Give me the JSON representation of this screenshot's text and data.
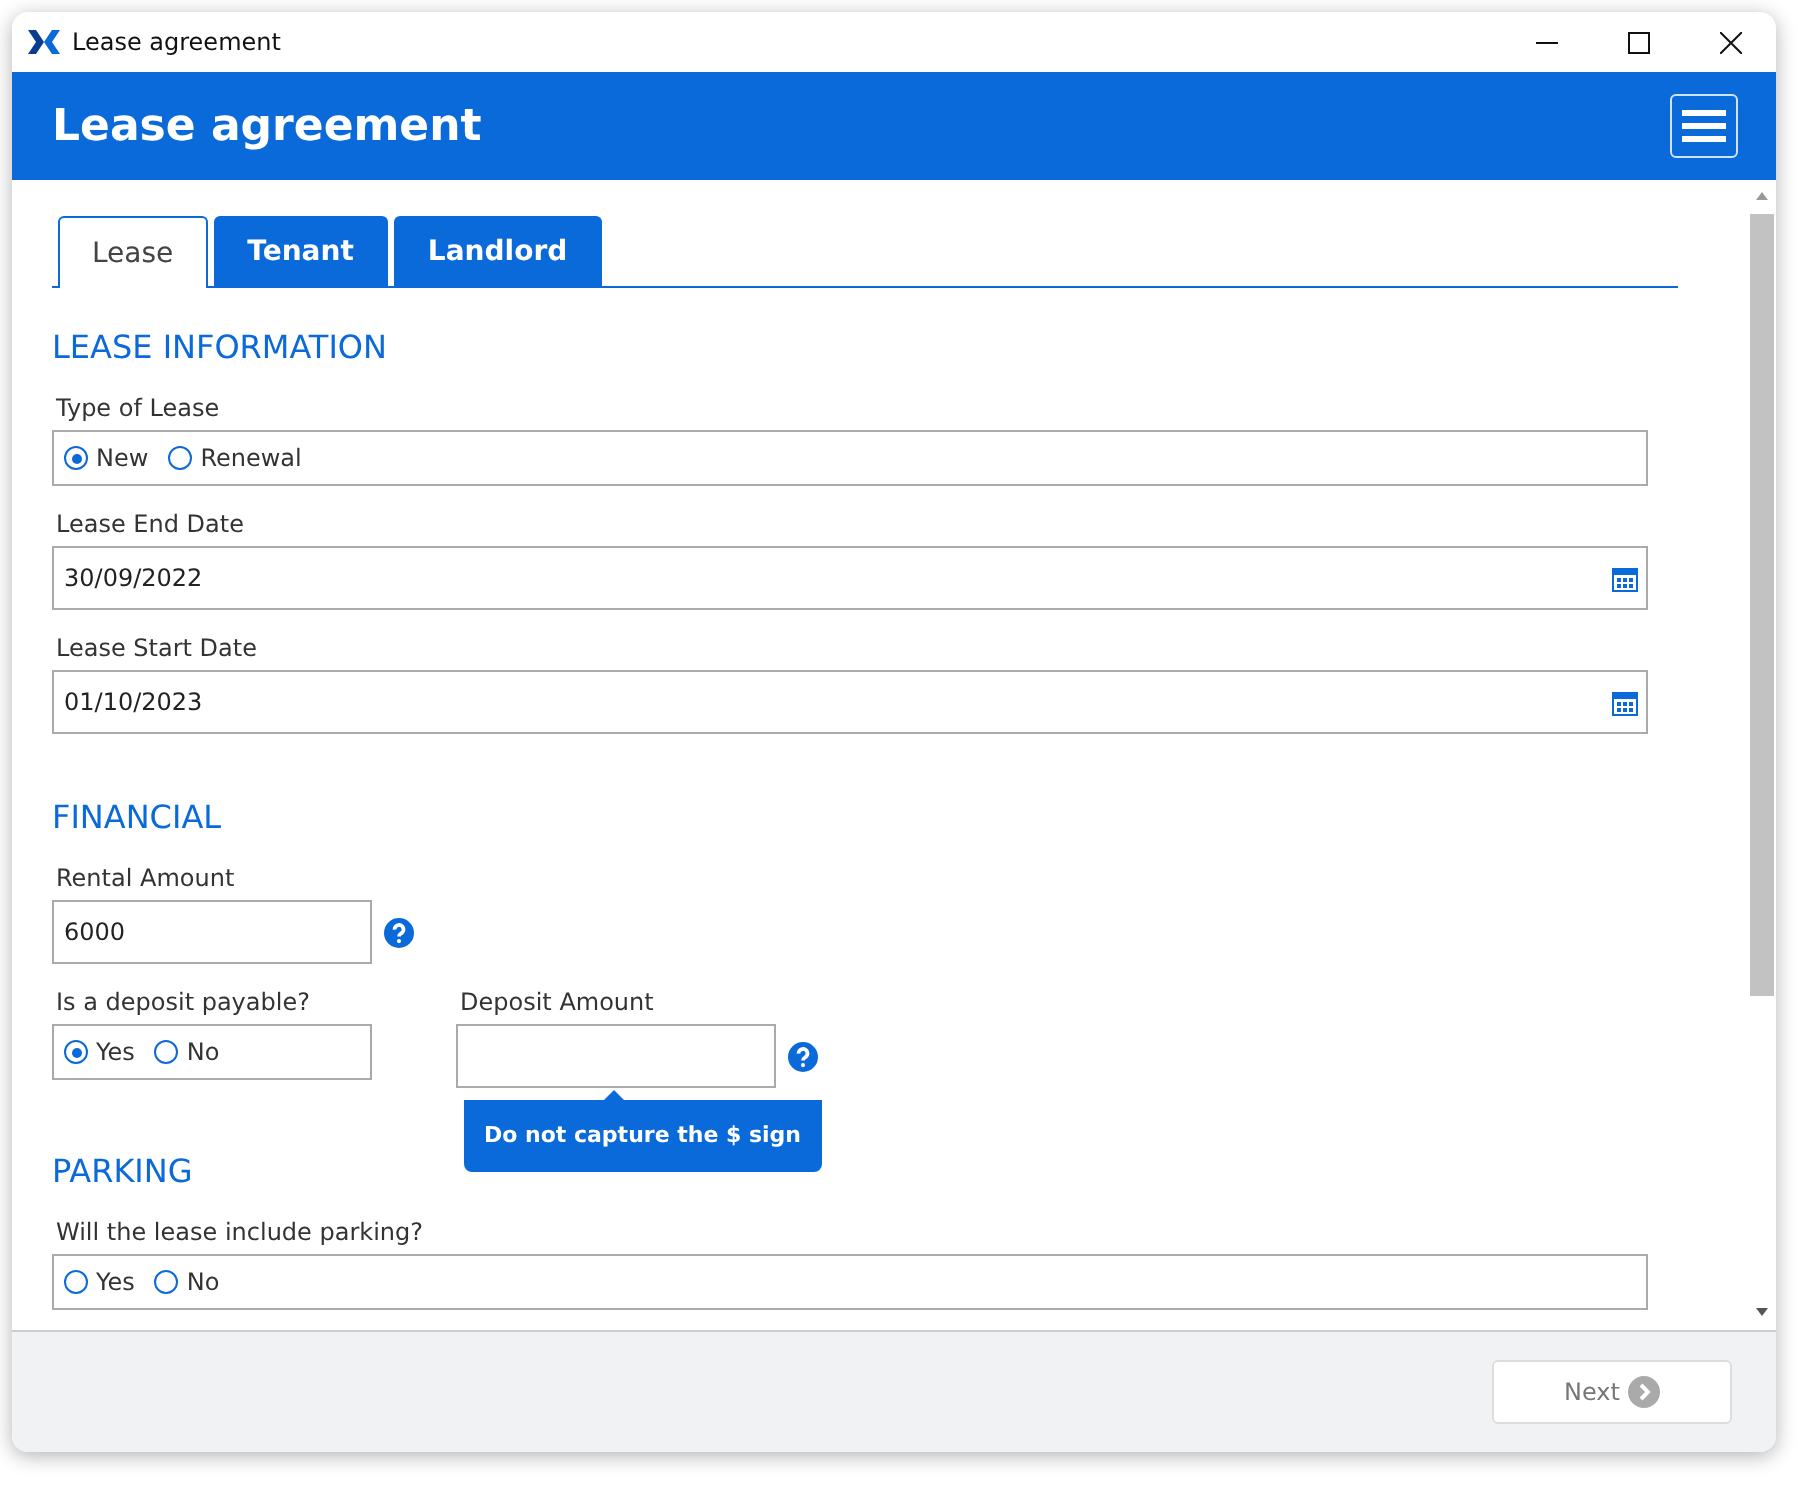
{
  "window": {
    "title": "Lease agreement"
  },
  "header": {
    "title": "Lease agreement"
  },
  "tabs": [
    {
      "label": "Lease",
      "selected": true
    },
    {
      "label": "Tenant",
      "selected": false
    },
    {
      "label": "Landlord",
      "selected": false
    }
  ],
  "sections": [
    {
      "title": "LEASE INFORMATION",
      "rows": [
        [
          {
            "kind": "radio",
            "label": "Type of Lease",
            "options": [
              {
                "label": "New",
                "selected": true
              },
              {
                "label": "Renewal",
                "selected": false
              }
            ]
          }
        ],
        [
          {
            "kind": "date",
            "label": "Lease End Date",
            "value": "30/09/2022"
          }
        ],
        [
          {
            "kind": "date",
            "label": "Lease Start Date",
            "value": "01/10/2023"
          }
        ]
      ]
    },
    {
      "title": "FINANCIAL",
      "rows": [
        [
          {
            "kind": "text",
            "label": "Rental Amount",
            "value": "6000",
            "help": true
          }
        ],
        [
          {
            "kind": "radio",
            "label": "Is a deposit payable?",
            "options": [
              {
                "label": "Yes",
                "selected": true
              },
              {
                "label": "No",
                "selected": false
              }
            ]
          },
          {
            "kind": "text",
            "label": "Deposit Amount",
            "help": true,
            "tooltip": "Do not capture the $ sign"
          }
        ]
      ]
    },
    {
      "title": "PARKING",
      "rows": [
        [
          {
            "kind": "radio",
            "label": "Will the lease include parking?",
            "options": [
              {
                "label": "Yes",
                "selected": false
              },
              {
                "label": "No",
                "selected": false
              }
            ]
          }
        ]
      ]
    }
  ],
  "footer": {
    "next": {
      "label": "Next",
      "disabled": true
    }
  }
}
